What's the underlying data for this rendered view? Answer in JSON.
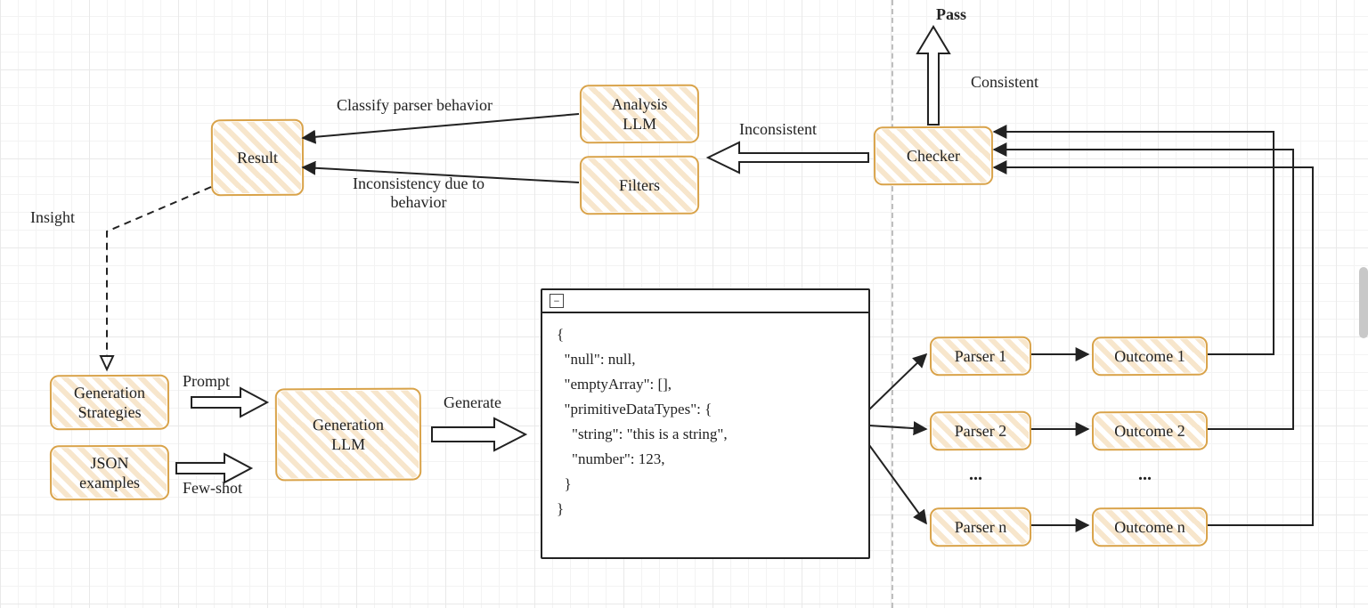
{
  "nodes": {
    "result": "Result",
    "analysis_llm": "Analysis\nLLM",
    "filters": "Filters",
    "checker": "Checker",
    "gen_strategies": "Generation\nStrategies",
    "json_examples": "JSON\nexamples",
    "generation_llm": "Generation\nLLM",
    "parser1": "Parser 1",
    "parser2": "Parser 2",
    "parsern": "Parser n",
    "outcome1": "Outcome 1",
    "outcome2": "Outcome 2",
    "outcomen": "Outcome n"
  },
  "labels": {
    "pass": "Pass",
    "consistent": "Consistent",
    "inconsistent": "Inconsistent",
    "classify": "Classify parser behavior",
    "incons_due": "Inconsistency due to\nbehavior",
    "insight": "Insight",
    "prompt": "Prompt",
    "fewshot": "Few-shot",
    "generate": "Generate",
    "dots": "..."
  },
  "code": "{\n  \"null\": null,\n  \"emptyArray\": [],\n  \"primitiveDataTypes\": {\n    \"string\": \"this is a string\",\n    \"number\": 123,\n  }\n}"
}
